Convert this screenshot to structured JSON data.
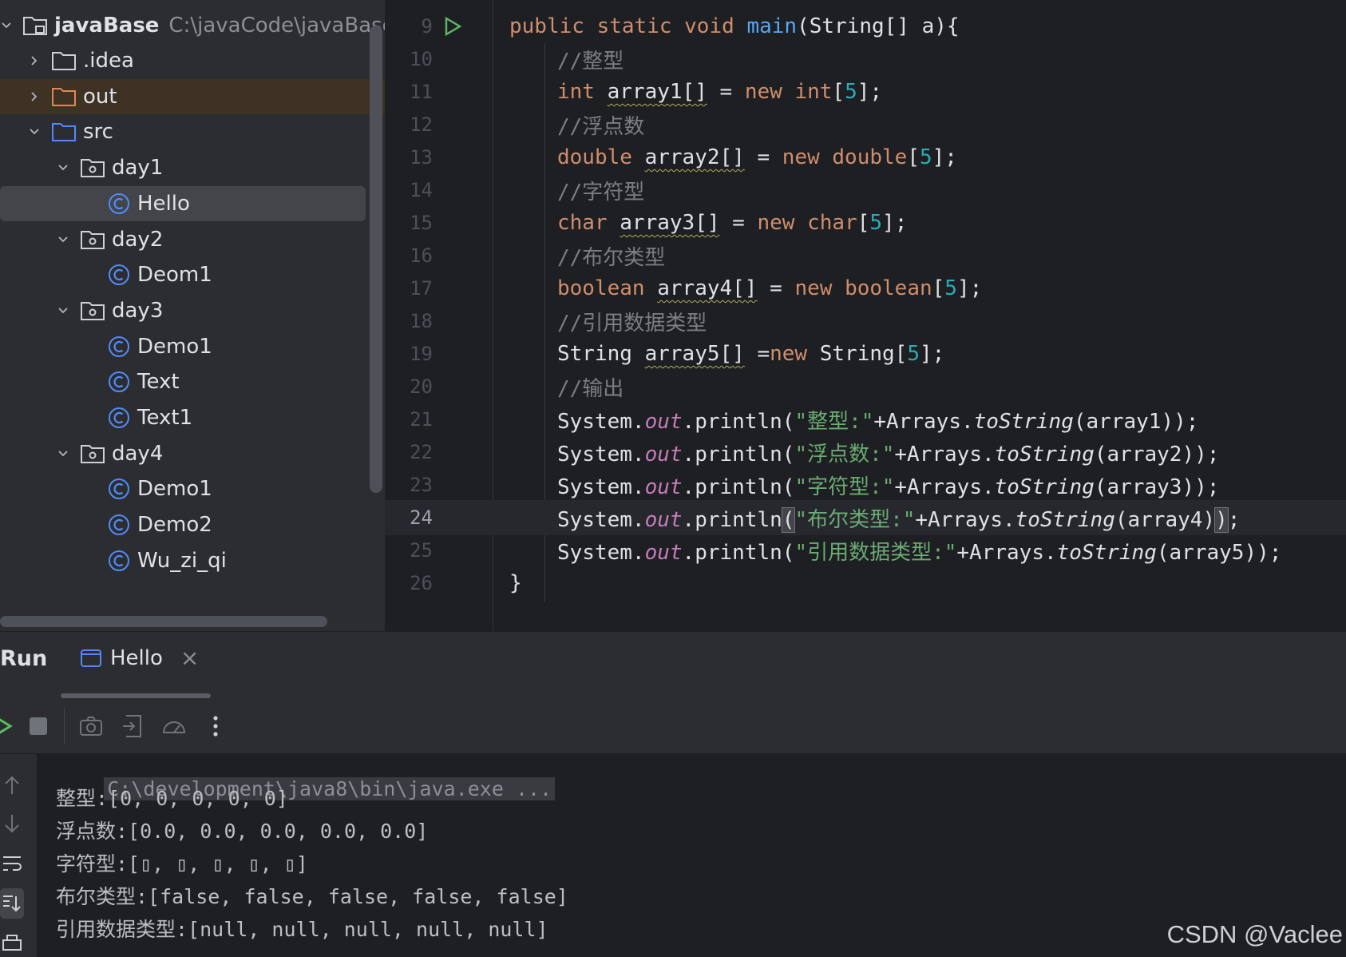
{
  "project_tree": {
    "root": {
      "name": "javaBase",
      "path": "C:\\javaCode\\javaBase"
    },
    "items": [
      {
        "label": ".idea",
        "kind": "folder",
        "level": 1,
        "expanded": false
      },
      {
        "label": "out",
        "kind": "folder-excluded",
        "level": 1,
        "expanded": false
      },
      {
        "label": "src",
        "kind": "folder-source",
        "level": 1,
        "expanded": true
      },
      {
        "label": "day1",
        "kind": "package",
        "level": 2,
        "expanded": true
      },
      {
        "label": "Hello",
        "kind": "class",
        "level": 3,
        "selected": true
      },
      {
        "label": "day2",
        "kind": "package",
        "level": 2,
        "expanded": true
      },
      {
        "label": "Deom1",
        "kind": "class",
        "level": 3
      },
      {
        "label": "day3",
        "kind": "package",
        "level": 2,
        "expanded": true
      },
      {
        "label": "Demo1",
        "kind": "class",
        "level": 3
      },
      {
        "label": "Text",
        "kind": "class",
        "level": 3
      },
      {
        "label": "Text1",
        "kind": "class",
        "level": 3
      },
      {
        "label": "day4",
        "kind": "package",
        "level": 2,
        "expanded": true
      },
      {
        "label": "Demo1",
        "kind": "class",
        "level": 3
      },
      {
        "label": "Demo2",
        "kind": "class",
        "level": 3
      },
      {
        "label": "Wu_zi_qi",
        "kind": "class",
        "level": 3
      }
    ]
  },
  "editor": {
    "current_line": 24,
    "lines": [
      {
        "n": "9",
        "run": true,
        "indent": 1,
        "tokens": [
          [
            "kw",
            "public "
          ],
          [
            "kw",
            "static "
          ],
          [
            "kw",
            "void "
          ],
          [
            "fn",
            "main"
          ],
          [
            "",
            "(String[] a){"
          ]
        ]
      },
      {
        "n": "10",
        "indent": 2,
        "tokens": [
          [
            "cmt",
            "//整型"
          ]
        ]
      },
      {
        "n": "11",
        "indent": 2,
        "tokens": [
          [
            "kw",
            "int "
          ],
          [
            "warn",
            "array1[]"
          ],
          [
            "",
            " = "
          ],
          [
            "kw",
            "new "
          ],
          [
            "kw",
            "int"
          ],
          [
            "",
            "["
          ],
          [
            "num",
            "5"
          ],
          [
            "",
            "];"
          ]
        ]
      },
      {
        "n": "12",
        "indent": 2,
        "tokens": [
          [
            "cmt",
            "//浮点数"
          ]
        ]
      },
      {
        "n": "13",
        "indent": 2,
        "tokens": [
          [
            "kw",
            "double "
          ],
          [
            "warn",
            "array2[]"
          ],
          [
            "",
            " = "
          ],
          [
            "kw",
            "new "
          ],
          [
            "kw",
            "double"
          ],
          [
            "",
            "["
          ],
          [
            "num",
            "5"
          ],
          [
            "",
            "];"
          ]
        ]
      },
      {
        "n": "14",
        "indent": 2,
        "tokens": [
          [
            "cmt",
            "//字符型"
          ]
        ]
      },
      {
        "n": "15",
        "indent": 2,
        "tokens": [
          [
            "kw",
            "char "
          ],
          [
            "warn",
            "array3[]"
          ],
          [
            "",
            " = "
          ],
          [
            "kw",
            "new "
          ],
          [
            "kw",
            "char"
          ],
          [
            "",
            "["
          ],
          [
            "num",
            "5"
          ],
          [
            "",
            "];"
          ]
        ]
      },
      {
        "n": "16",
        "indent": 2,
        "tokens": [
          [
            "cmt",
            "//布尔类型"
          ]
        ]
      },
      {
        "n": "17",
        "indent": 2,
        "tokens": [
          [
            "kw",
            "boolean "
          ],
          [
            "warn",
            "array4[]"
          ],
          [
            "",
            " = "
          ],
          [
            "kw",
            "new "
          ],
          [
            "kw",
            "boolean"
          ],
          [
            "",
            "["
          ],
          [
            "num",
            "5"
          ],
          [
            "",
            "];"
          ]
        ]
      },
      {
        "n": "18",
        "indent": 2,
        "tokens": [
          [
            "cmt",
            "//引用数据类型"
          ]
        ]
      },
      {
        "n": "19",
        "indent": 2,
        "tokens": [
          [
            "",
            "String "
          ],
          [
            "warn",
            "array5[]"
          ],
          [
            "",
            " ="
          ],
          [
            "kw",
            "new "
          ],
          [
            "",
            "String["
          ],
          [
            "num",
            "5"
          ],
          [
            "",
            "];"
          ]
        ]
      },
      {
        "n": "20",
        "indent": 2,
        "tokens": [
          [
            "cmt",
            "//输出"
          ]
        ]
      },
      {
        "n": "21",
        "indent": 2,
        "tokens": [
          [
            "",
            "System."
          ],
          [
            "fld",
            "out"
          ],
          [
            "",
            ".println("
          ],
          [
            "str",
            "\"整型:\""
          ],
          [
            "",
            "+Arrays."
          ],
          [
            "it",
            "toString"
          ],
          [
            "",
            "(array1));"
          ]
        ]
      },
      {
        "n": "22",
        "indent": 2,
        "tokens": [
          [
            "",
            "System."
          ],
          [
            "fld",
            "out"
          ],
          [
            "",
            ".println("
          ],
          [
            "str",
            "\"浮点数:\""
          ],
          [
            "",
            "+Arrays."
          ],
          [
            "it",
            "toString"
          ],
          [
            "",
            "(array2));"
          ]
        ]
      },
      {
        "n": "23",
        "indent": 2,
        "tokens": [
          [
            "",
            "System."
          ],
          [
            "fld",
            "out"
          ],
          [
            "",
            ".println("
          ],
          [
            "str",
            "\"字符型:\""
          ],
          [
            "",
            "+Arrays."
          ],
          [
            "it",
            "toString"
          ],
          [
            "",
            "(array3));"
          ]
        ]
      },
      {
        "n": "24",
        "indent": 2,
        "tokens": [
          [
            "",
            "System."
          ],
          [
            "fld",
            "out"
          ],
          [
            "",
            ".println"
          ],
          [
            "brk",
            "("
          ],
          [
            "str",
            "\"布尔类型:\""
          ],
          [
            "",
            "+Arrays."
          ],
          [
            "it",
            "toString"
          ],
          [
            "",
            "(array4)"
          ],
          [
            "brk",
            ")"
          ],
          [
            "",
            ";"
          ]
        ]
      },
      {
        "n": "25",
        "indent": 2,
        "tokens": [
          [
            "",
            "System."
          ],
          [
            "fld",
            "out"
          ],
          [
            "",
            ".println("
          ],
          [
            "str",
            "\"引用数据类型:\""
          ],
          [
            "",
            "+Arrays."
          ],
          [
            "it",
            "toString"
          ],
          [
            "",
            "(array5));"
          ]
        ]
      },
      {
        "n": "26",
        "indent": 1,
        "tokens": [
          [
            "",
            "}"
          ]
        ]
      }
    ]
  },
  "run_window": {
    "title": "Run",
    "tab": {
      "label": "Hello",
      "close": "×"
    },
    "console": {
      "command": "C:\\development\\java8\\bin\\java.exe ...",
      "output": [
        "整型:[0, 0, 0, 0, 0]",
        "浮点数:[0.0, 0.0, 0.0, 0.0, 0.0]",
        "字符型:[▯, ▯, ▯, ▯, ▯]",
        "布尔类型:[false, false, false, false, false]",
        "引用数据类型:[null, null, null, null, null]"
      ]
    }
  },
  "watermark": "CSDN @Vaclee",
  "colors": {
    "keyword": "#cf8e6d",
    "function": "#56a8f5",
    "number": "#2aacb8",
    "string": "#6aab73",
    "comment": "#7a7e85",
    "field": "#c77dbb",
    "run_green": "#5fb865"
  }
}
